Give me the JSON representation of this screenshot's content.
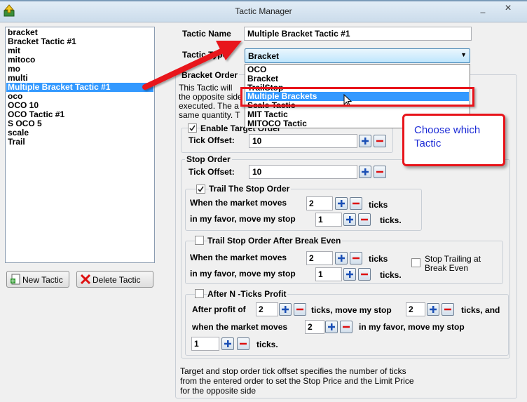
{
  "window": {
    "title": "Tactic Manager",
    "minimize": "_",
    "close": "×"
  },
  "tactic_list": {
    "items": [
      "bracket",
      "Bracket Tactic #1",
      "mit",
      "mitoco",
      "mo",
      "multi",
      "Multiple Bracket Tactic #1",
      "oco",
      "OCO 10",
      "OCO Tactic #1",
      "S OCO 5",
      "scale",
      "Trail"
    ],
    "selected": "Multiple Bracket Tactic #1"
  },
  "buttons": {
    "new_tactic": "New Tactic",
    "delete_tactic": "Delete Tactic"
  },
  "form": {
    "tactic_name_label": "Tactic Name",
    "tactic_name_value": "Multiple Bracket Tactic #1",
    "tactic_type_label": "Tactic Type",
    "tactic_type_value": "Bracket",
    "tactic_type_options": [
      "OCO",
      "Bracket",
      "TrailStop",
      "Multiple Brackets",
      "Scale Tactic",
      "MIT Tactic",
      "MITOCO Tactic"
    ],
    "tactic_type_highlighted": "Multiple Brackets"
  },
  "bracket_order": {
    "group_label": "Bracket Order",
    "desc_line1": "This Tactic will",
    "desc_line2": "the opposite side",
    "desc_line3": "executed. The a",
    "desc_line4": "same quantity. T",
    "enable_target_label": "Enable Target Order",
    "enable_target_checked": true,
    "target_tick_offset_label": "Tick Offset:",
    "target_tick_offset_value": "10"
  },
  "stop_order": {
    "group_label": "Stop Order",
    "tick_offset_label": "Tick Offset:",
    "tick_offset_value": "10",
    "trail": {
      "label": "Trail The Stop Order",
      "checked": true,
      "when_label": "When the market moves",
      "when_value": "2",
      "ticks_label": "ticks",
      "favor_label": "in my favor, move my stop",
      "favor_value": "1",
      "ticks2_label": "ticks."
    },
    "trail_break_even": {
      "label": "Trail Stop Order After Break Even",
      "checked": false,
      "when_label": "When the market moves",
      "when_value": "2",
      "ticks_label": "ticks",
      "favor_label": "in my favor, move my stop",
      "favor_value": "1",
      "ticks2_label": "ticks.",
      "stop_trailing_label_1": "Stop Trailing at",
      "stop_trailing_label_2": "Break Even",
      "stop_trailing_checked": false
    },
    "after_n_ticks": {
      "label": "After N -Ticks Profit",
      "checked": false,
      "after_profit_label": "After profit of",
      "after_profit_value": "2",
      "ticks_move_label": "ticks, move my stop",
      "move_value": "2",
      "ticks_and_label": "ticks, and",
      "when_label": "when the market moves",
      "when_value": "2",
      "favor_label": "in my favor, move my stop",
      "stop_value": "1",
      "ticks_label": "ticks."
    }
  },
  "footer": {
    "line1": "Target and stop order tick offset specifies the number of ticks",
    "line2": "from the entered order to set the Stop Price and the Limit Price",
    "line3": "for the opposite side"
  },
  "annotation": {
    "callout_text": "Choose which Tactic",
    "accent_red": "#e8141b",
    "callout_text_color": "#1c2bd6"
  },
  "colors": {
    "selection": "#3399ff"
  }
}
